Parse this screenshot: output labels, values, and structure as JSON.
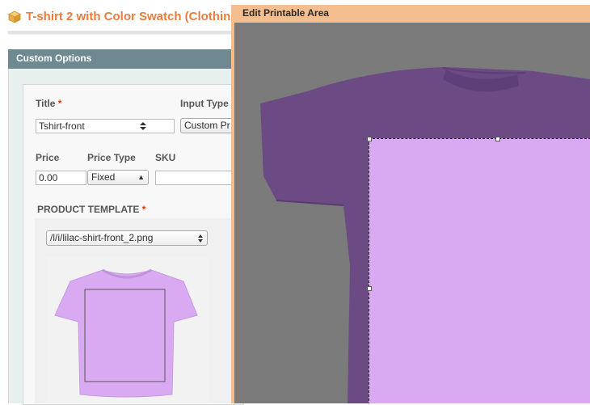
{
  "page": {
    "title": "T-shirt 2 with Color Swatch (Clothin",
    "accent_color": "#eb7c3b"
  },
  "custom_options": {
    "header": "Custom Options",
    "title_label": "Title",
    "title_required": "*",
    "title_value": "Tshirt-front",
    "input_type_label": "Input Type",
    "input_type_value": "Custom Pr",
    "price_label": "Price",
    "price_value": "0.00",
    "price_type_label": "Price Type",
    "price_type_value": "Fixed",
    "sku_label": "SKU",
    "sku_value": "",
    "product_template_label": "PRODUCT TEMPLATE",
    "product_template_required": "*",
    "product_template_value": "/l/i/lilac-shirt-front_2.png"
  },
  "modal": {
    "title": "Edit Printable Area",
    "shirt_color": "#d9aaf2",
    "shade_color": "#7b7b7b"
  },
  "icons": {
    "product": "box-icon",
    "select": "select-arrows-icon",
    "handle": "resize-handle-icon"
  }
}
